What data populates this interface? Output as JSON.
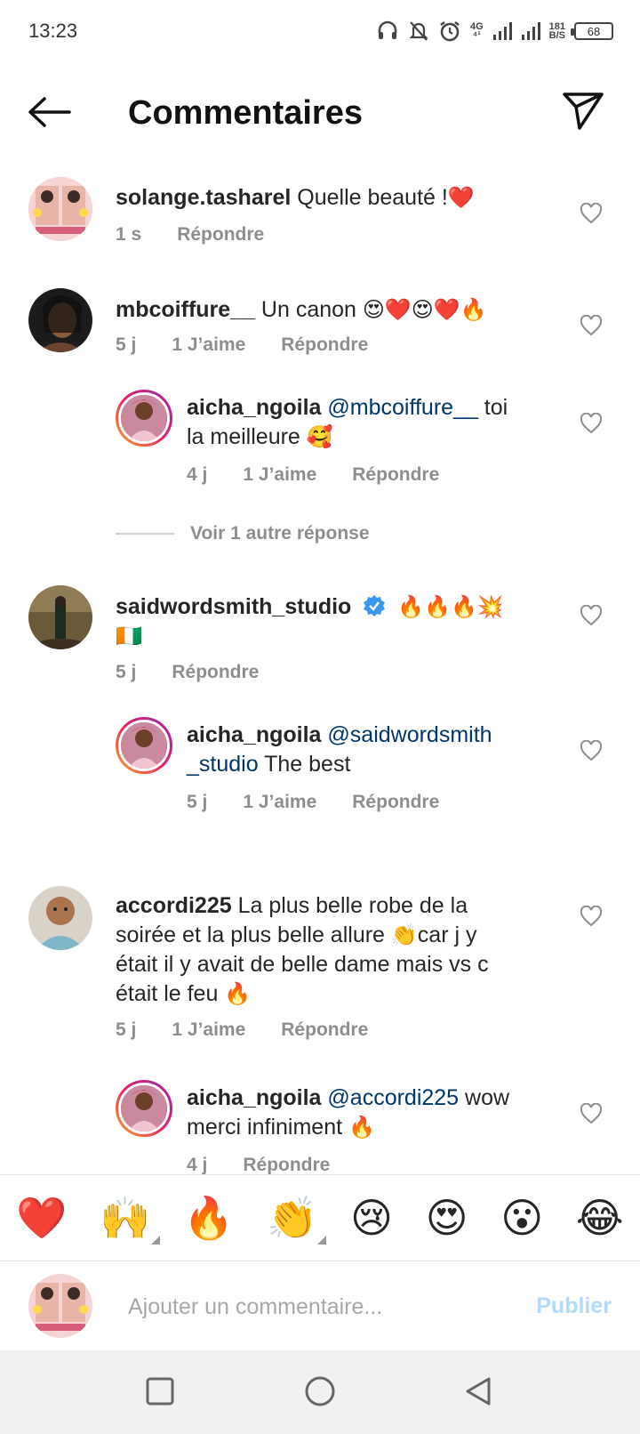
{
  "status": {
    "time": "13:23",
    "net1": "4G",
    "speed_top": "181",
    "speed_bottom": "B/S",
    "battery": "68"
  },
  "header": {
    "title": "Commentaires"
  },
  "comments": [
    {
      "user": "solange.tasharel",
      "text": " Quelle beauté !",
      "emoji": "❤️",
      "time": "1 s",
      "likes": "",
      "reply": "Répondre"
    },
    {
      "user": "mbcoiffure__",
      "text": " Un canon ",
      "emoji": "😍❤️😍❤️🔥",
      "time": "5 j",
      "likes": "1 J’aime",
      "reply": "Répondre"
    },
    {
      "user": "aicha_ngoila",
      "mention": "@mbcoiffure__",
      "text1": " toi",
      "text2": "la meilleure ",
      "emoji": "🥰",
      "time": "4 j",
      "likes": "1 J’aime",
      "reply": "Répondre"
    },
    {
      "view_more": "Voir 1 autre réponse"
    },
    {
      "user": "saidwordsmith_studio",
      "emoji": "🔥🔥🔥💥",
      "emoji2": "🇨🇮",
      "time": "5 j",
      "likes": "",
      "reply": "Répondre"
    },
    {
      "user": "aicha_ngoila",
      "mention1": "@saidwordsmith",
      "mention2": "_studio",
      "text": " The best",
      "time": "5 j",
      "likes": "1 J’aime",
      "reply": "Répondre"
    },
    {
      "user": "accordi225",
      "text1": " La plus belle robe de la",
      "text2": "soirée et la plus belle allure ",
      "emoji": "👏",
      "text3": "car j y",
      "text4": "était il y avait de belle dame mais vs c",
      "text5": "était le feu ",
      "emoji2": "🔥",
      "time": "5 j",
      "likes": "1 J’aime",
      "reply": "Répondre"
    },
    {
      "user": "aicha_ngoila",
      "mention": "@accordi225",
      "text1": " wow",
      "text2": "merci infiniment ",
      "emoji": "🔥",
      "time": "4 j",
      "reply": "Répondre"
    }
  ],
  "emoji_bar": [
    "❤️",
    "🙌",
    "🔥",
    "👏",
    "😢",
    "😍",
    "😮",
    "😂"
  ],
  "composer": {
    "placeholder": "Ajouter un commentaire...",
    "publish": "Publier"
  },
  "colors": {
    "mention": "#00376b",
    "publish": "#b3dbff",
    "meta": "#8e8e8e"
  },
  "icons": {
    "back": "arrow-left-icon",
    "send": "paper-plane-icon",
    "heart": "heart-outline-icon",
    "verified": "verified-badge-icon"
  }
}
